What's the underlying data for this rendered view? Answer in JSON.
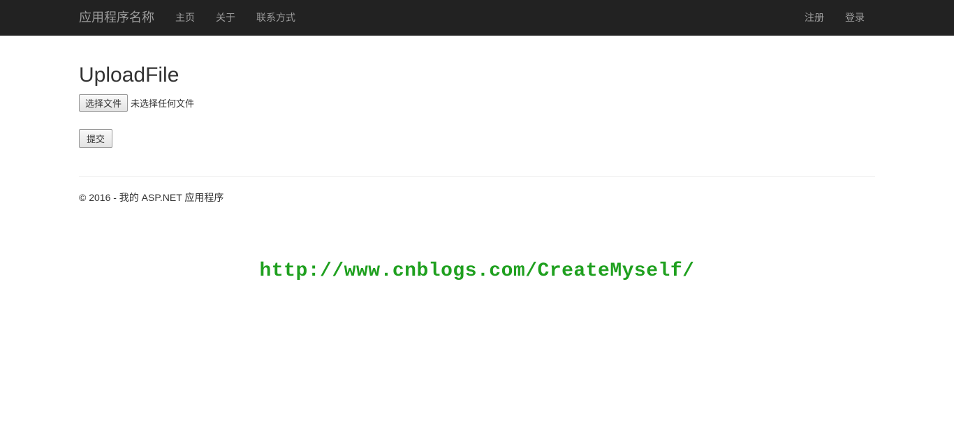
{
  "navbar": {
    "brand": "应用程序名称",
    "left_links": [
      {
        "label": "主页"
      },
      {
        "label": "关于"
      },
      {
        "label": "联系方式"
      }
    ],
    "right_links": [
      {
        "label": "注册"
      },
      {
        "label": "登录"
      }
    ]
  },
  "main": {
    "heading": "UploadFile",
    "file_input": {
      "button_label": "选择文件",
      "status_text": "未选择任何文件"
    },
    "submit_label": "提交"
  },
  "footer": {
    "copyright": "© 2016 - 我的 ASP.NET 应用程序"
  },
  "watermark": {
    "text": "http://www.cnblogs.com/CreateMyself/"
  }
}
